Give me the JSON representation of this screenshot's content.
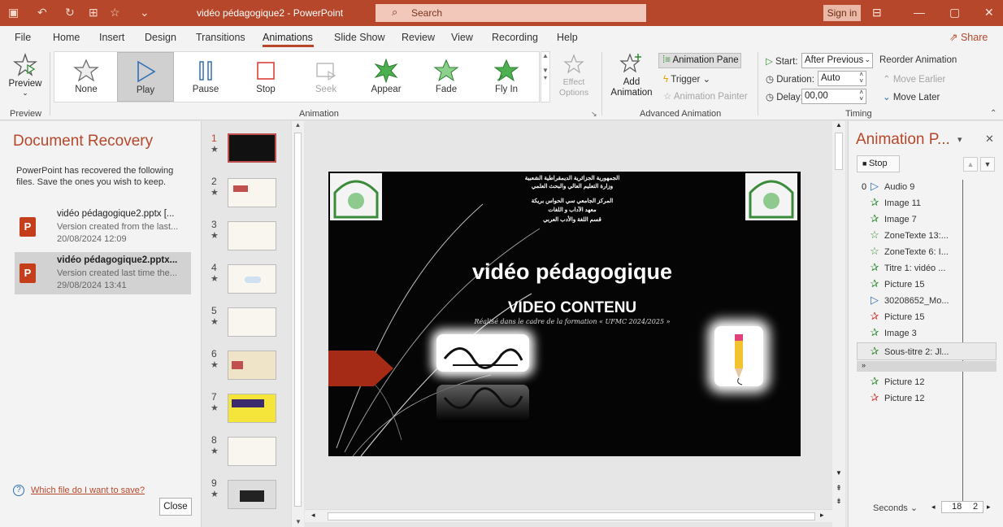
{
  "titlebar": {
    "doc_title": "vidéo pédagogique2 - PowerPoint",
    "search_placeholder": "Search",
    "sign_in": "Sign in"
  },
  "menu": {
    "tabs": [
      "File",
      "Home",
      "Insert",
      "Design",
      "Transitions",
      "Animations",
      "Slide Show",
      "Review",
      "View",
      "Recording",
      "Help"
    ],
    "active_tab": "Animations",
    "share": "Share"
  },
  "ribbon": {
    "preview_label": "Preview",
    "preview_group": "Preview",
    "animation_group": "Animation",
    "gallery": [
      "None",
      "Play",
      "Pause",
      "Stop",
      "Seek",
      "Appear",
      "Fade",
      "Fly In"
    ],
    "selected": "Play",
    "effect_options": "Effect Options",
    "add_animation_1": "Add",
    "add_animation_2": "Animation",
    "animation_pane": "Animation Pane",
    "trigger": "Trigger",
    "animation_painter": "Animation Painter",
    "advanced_group": "Advanced Animation",
    "start_label": "Start:",
    "start_value": "After Previous",
    "duration_label": "Duration:",
    "duration_value": "Auto",
    "delay_label": "Delay:",
    "delay_value": "00,00",
    "reorder": "Reorder Animation",
    "move_earlier": "Move Earlier",
    "move_later": "Move Later",
    "timing_group": "Timing"
  },
  "recovery": {
    "title": "Document Recovery",
    "description": "PowerPoint has recovered the following files.  Save the ones you wish to keep.",
    "files": [
      {
        "name": "vidéo pédagogique2.pptx  [...",
        "desc": "Version created from the last...",
        "date": "20/08/2024 12:09"
      },
      {
        "name": "vidéo pédagogique2.pptx...",
        "desc": "Version created last time the...",
        "date": "29/08/2024 13:41"
      }
    ],
    "help_link": "Which file do I want to save?",
    "close": "Close"
  },
  "thumbnails": [
    "1",
    "2",
    "3",
    "4",
    "5",
    "6",
    "7",
    "8",
    "9"
  ],
  "slide": {
    "arabic_lines": [
      "الجمهورية الجزائرية الديمقراطية الشعبية",
      "وزارة التعليم العالي والبحث العلمي",
      "المركز الجامعي سي الحواس بريكة",
      "معهد الآداب و اللغات",
      "قسم اللغة والأدب العربي"
    ],
    "title": "vidéo pédagogique",
    "subtitle": "VIDEO CONTENU",
    "note": "Réalisé dans le cadre de la formation « UFMC 2024/2025 »"
  },
  "animation_pane": {
    "title": "Animation P...",
    "stop": "Stop",
    "items": [
      {
        "label": "Audio 9",
        "icon": "play-icon",
        "prefix": "0"
      },
      {
        "label": "Image 11",
        "icon": "fly-in-icon"
      },
      {
        "label": "Image 7",
        "icon": "fly-in-icon"
      },
      {
        "label": "ZoneTexte 13:...",
        "icon": "fade-icon"
      },
      {
        "label": "ZoneTexte 6: I...",
        "icon": "fade-icon"
      },
      {
        "label": "Titre 1: vidéo ...",
        "icon": "fly-in-icon"
      },
      {
        "label": "Picture 15",
        "icon": "fly-in-icon"
      },
      {
        "label": "30208652_Mo...",
        "icon": "play-icon"
      },
      {
        "label": "Picture 15",
        "icon": "exit-icon"
      },
      {
        "label": "Image 3",
        "icon": "fly-in-icon"
      },
      {
        "label": "Sous-titre 2: Jl...",
        "icon": "fly-in-icon"
      },
      {
        "label": "Picture 12",
        "icon": "fly-in-icon"
      },
      {
        "label": "Picture 12",
        "icon": "exit-icon"
      }
    ],
    "seconds": "Seconds",
    "timeline_start": "18",
    "timeline_end": "2"
  },
  "colors": {
    "accent": "#b7472a",
    "green": "#2e8b2e",
    "red": "#d9342b",
    "blue": "#2f6fb6"
  }
}
